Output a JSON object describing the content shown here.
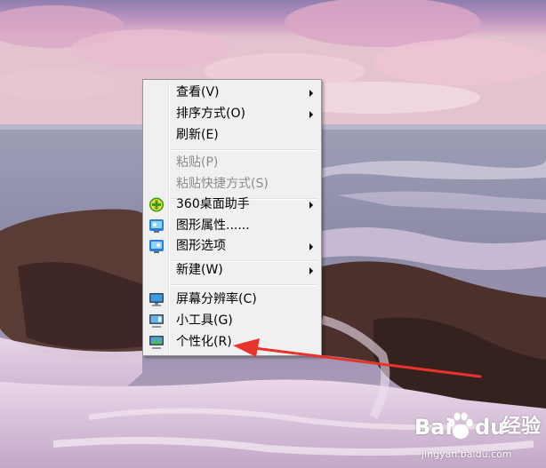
{
  "context_menu": {
    "items": [
      {
        "label": "查看(V)",
        "submenu": true,
        "disabled": false,
        "icon": ""
      },
      {
        "label": "排序方式(O)",
        "submenu": true,
        "disabled": false,
        "icon": ""
      },
      {
        "label": "刷新(E)",
        "submenu": false,
        "disabled": false,
        "icon": ""
      },
      {
        "label": "粘贴(P)",
        "submenu": false,
        "disabled": true,
        "icon": ""
      },
      {
        "label": "粘贴快捷方式(S)",
        "submenu": false,
        "disabled": true,
        "icon": ""
      },
      {
        "label": "360桌面助手",
        "submenu": true,
        "disabled": false,
        "icon": "360-plus-icon"
      },
      {
        "label": "图形属性......",
        "submenu": false,
        "disabled": false,
        "icon": "graphics-properties-icon"
      },
      {
        "label": "图形选项",
        "submenu": true,
        "disabled": false,
        "icon": "graphics-options-icon"
      },
      {
        "label": "新建(W)",
        "submenu": true,
        "disabled": false,
        "icon": ""
      },
      {
        "label": "屏幕分辨率(C)",
        "submenu": false,
        "disabled": false,
        "icon": "monitor-icon"
      },
      {
        "label": "小工具(G)",
        "submenu": false,
        "disabled": false,
        "icon": "gadgets-icon"
      },
      {
        "label": "个性化(R)",
        "submenu": false,
        "disabled": false,
        "icon": "personalize-icon"
      }
    ]
  },
  "annotation": {
    "color": "#e8332b"
  },
  "watermark": {
    "brand_left": "Bai",
    "brand_right": "du",
    "product": "经验",
    "url": "jingyan.baidu.com"
  },
  "colors": {
    "menu_bg": "#f0f0f0",
    "menu_border": "#979797",
    "disabled_text": "#8d8d8d",
    "annotation_red": "#e8332b"
  }
}
